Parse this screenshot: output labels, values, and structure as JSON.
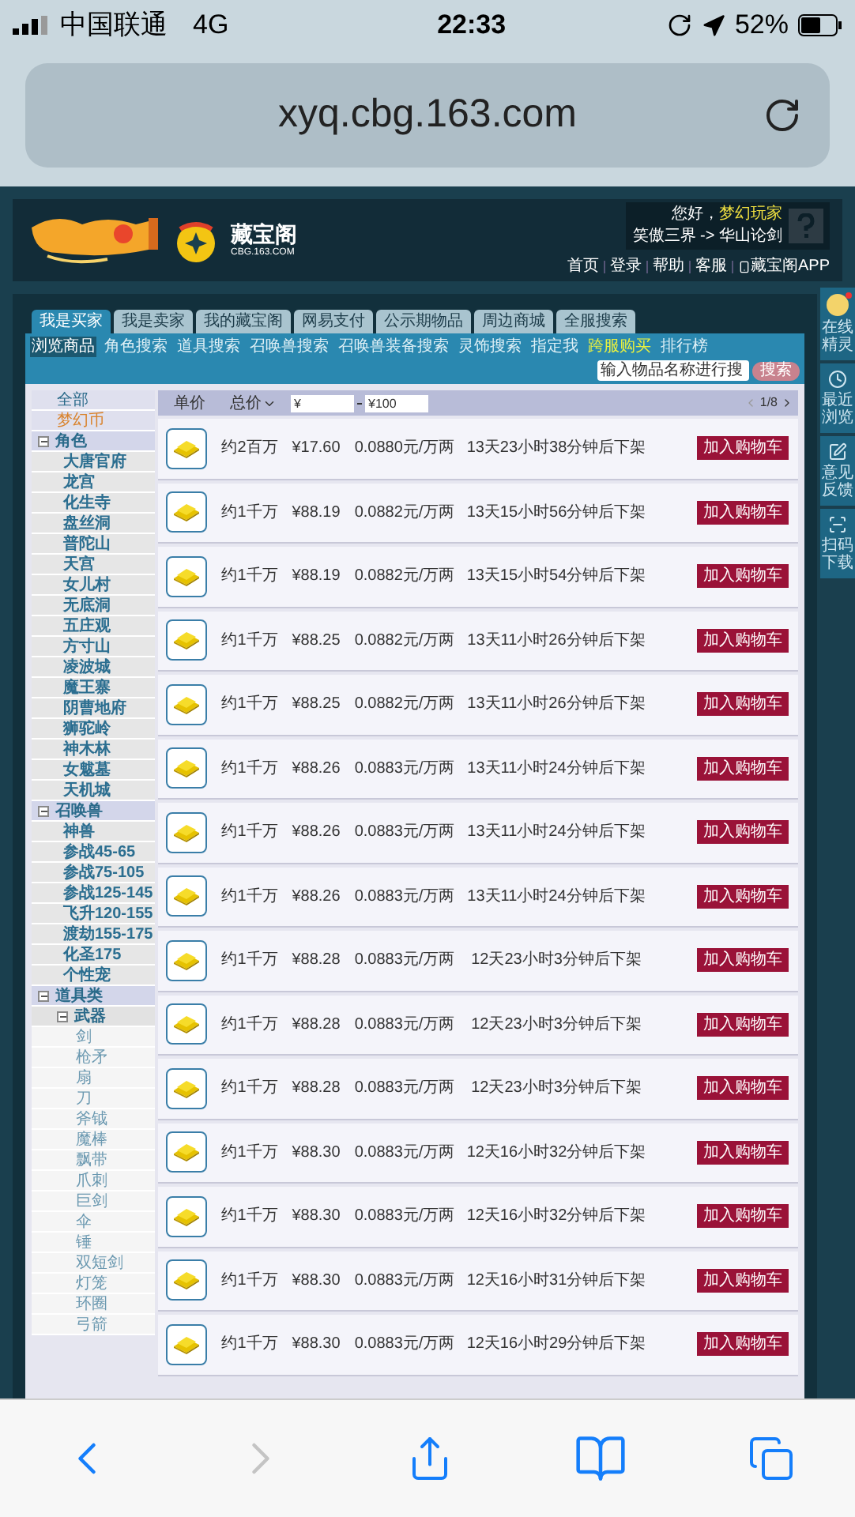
{
  "status_bar": {
    "carrier": "中国联通",
    "network": "4G",
    "time": "22:33",
    "battery": "52%"
  },
  "address_bar": {
    "url": "xyq.cbg.163.com"
  },
  "header": {
    "brand": "藏宝阁",
    "brand_sub": "CBG.163.COM",
    "greeting": "您好，",
    "username": "梦幻玩家",
    "server": "笑傲三界 -> 华山论剑",
    "links": [
      {
        "label": "首页",
        "kind": "text"
      },
      {
        "label": "登录",
        "kind": "text"
      },
      {
        "label": "帮助",
        "kind": "text"
      },
      {
        "label": "客服",
        "kind": "text"
      },
      {
        "label": "藏宝阁APP",
        "kind": "app"
      }
    ]
  },
  "tabs": [
    {
      "label": "我是买家",
      "selected": true
    },
    {
      "label": "我是卖家",
      "selected": false
    },
    {
      "label": "我的藏宝阁",
      "selected": false
    },
    {
      "label": "网易支付",
      "selected": false
    },
    {
      "label": "公示期物品",
      "selected": false
    },
    {
      "label": "周边商城",
      "selected": false
    },
    {
      "label": "全服搜索",
      "selected": false
    }
  ],
  "subnav": {
    "items": [
      {
        "label": "浏览商品",
        "selected": true,
        "highlighted": false
      },
      {
        "label": "角色搜索",
        "selected": false,
        "highlighted": false
      },
      {
        "label": "道具搜索",
        "selected": false,
        "highlighted": false
      },
      {
        "label": "召唤兽搜索",
        "selected": false,
        "highlighted": false
      },
      {
        "label": "召唤兽装备搜索",
        "selected": false,
        "highlighted": false
      },
      {
        "label": "灵饰搜索",
        "selected": false,
        "highlighted": false
      },
      {
        "label": "指定我",
        "selected": false,
        "highlighted": false
      },
      {
        "label": "跨服购买",
        "selected": false,
        "highlighted": true
      },
      {
        "label": "排行榜",
        "selected": false,
        "highlighted": false
      }
    ],
    "search_placeholder": "输入物品名称进行搜",
    "search_button": "搜索"
  },
  "sidebar": {
    "items": [
      {
        "label": "全部",
        "selected": false
      },
      {
        "label": "梦幻币",
        "selected": true
      },
      {
        "label": "角色",
        "selected": false,
        "expanded": true,
        "children": [
          {
            "label": "大唐官府",
            "selected": false
          },
          {
            "label": "龙宫",
            "selected": false
          },
          {
            "label": "化生寺",
            "selected": false
          },
          {
            "label": "盘丝洞",
            "selected": false
          },
          {
            "label": "普陀山",
            "selected": false
          },
          {
            "label": "天宫",
            "selected": false
          },
          {
            "label": "女儿村",
            "selected": false
          },
          {
            "label": "无底洞",
            "selected": false
          },
          {
            "label": "五庄观",
            "selected": false
          },
          {
            "label": "方寸山",
            "selected": false
          },
          {
            "label": "凌波城",
            "selected": false
          },
          {
            "label": "魔王寨",
            "selected": false
          },
          {
            "label": "阴曹地府",
            "selected": false
          },
          {
            "label": "狮驼岭",
            "selected": false
          },
          {
            "label": "神木林",
            "selected": false
          },
          {
            "label": "女魃墓",
            "selected": false
          },
          {
            "label": "天机城",
            "selected": false
          }
        ]
      },
      {
        "label": "召唤兽",
        "selected": false,
        "expanded": true,
        "children": [
          {
            "label": "神兽",
            "selected": false
          },
          {
            "label": "参战45-65",
            "selected": false
          },
          {
            "label": "参战75-105",
            "selected": false
          },
          {
            "label": "参战125-145",
            "selected": false
          },
          {
            "label": "飞升120-155",
            "selected": false
          },
          {
            "label": "渡劫155-175",
            "selected": false
          },
          {
            "label": "化圣175",
            "selected": false
          },
          {
            "label": "个性宠",
            "selected": false
          }
        ]
      },
      {
        "label": "道具类",
        "selected": false,
        "expanded": true,
        "children": [
          {
            "label": "武器",
            "selected": false,
            "expanded": true,
            "children": [
              {
                "label": "剑",
                "selected": false
              },
              {
                "label": "枪矛",
                "selected": false
              },
              {
                "label": "扇",
                "selected": false
              },
              {
                "label": "刀",
                "selected": false
              },
              {
                "label": "斧钺",
                "selected": false
              },
              {
                "label": "魔棒",
                "selected": false
              },
              {
                "label": "飘带",
                "selected": false
              },
              {
                "label": "爪刺",
                "selected": false
              },
              {
                "label": "巨剑",
                "selected": false
              },
              {
                "label": "伞",
                "selected": false
              },
              {
                "label": "锤",
                "selected": false
              },
              {
                "label": "双短剑",
                "selected": false
              },
              {
                "label": "灯笼",
                "selected": false
              },
              {
                "label": "环圈",
                "selected": false
              },
              {
                "label": "弓箭",
                "selected": false
              }
            ]
          }
        ]
      }
    ]
  },
  "table": {
    "columns": [
      "单价",
      "总价"
    ],
    "min_price": "¥",
    "max_price": "¥100",
    "page": "1/8",
    "rows": [
      {
        "amount": "约2百万",
        "price": "¥17.60",
        "unit_price": "0.0880元/万两",
        "expires": "13天23小时38分钟后下架",
        "button": "加入购物车"
      },
      {
        "amount": "约1千万",
        "price": "¥88.19",
        "unit_price": "0.0882元/万两",
        "expires": "13天15小时56分钟后下架",
        "button": "加入购物车"
      },
      {
        "amount": "约1千万",
        "price": "¥88.19",
        "unit_price": "0.0882元/万两",
        "expires": "13天15小时54分钟后下架",
        "button": "加入购物车"
      },
      {
        "amount": "约1千万",
        "price": "¥88.25",
        "unit_price": "0.0882元/万两",
        "expires": "13天11小时26分钟后下架",
        "button": "加入购物车"
      },
      {
        "amount": "约1千万",
        "price": "¥88.25",
        "unit_price": "0.0882元/万两",
        "expires": "13天11小时26分钟后下架",
        "button": "加入购物车"
      },
      {
        "amount": "约1千万",
        "price": "¥88.26",
        "unit_price": "0.0883元/万两",
        "expires": "13天11小时24分钟后下架",
        "button": "加入购物车"
      },
      {
        "amount": "约1千万",
        "price": "¥88.26",
        "unit_price": "0.0883元/万两",
        "expires": "13天11小时24分钟后下架",
        "button": "加入购物车"
      },
      {
        "amount": "约1千万",
        "price": "¥88.26",
        "unit_price": "0.0883元/万两",
        "expires": "13天11小时24分钟后下架",
        "button": "加入购物车"
      },
      {
        "amount": "约1千万",
        "price": "¥88.28",
        "unit_price": "0.0883元/万两",
        "expires": "12天23小时3分钟后下架",
        "button": "加入购物车"
      },
      {
        "amount": "约1千万",
        "price": "¥88.28",
        "unit_price": "0.0883元/万两",
        "expires": "12天23小时3分钟后下架",
        "button": "加入购物车"
      },
      {
        "amount": "约1千万",
        "price": "¥88.28",
        "unit_price": "0.0883元/万两",
        "expires": "12天23小时3分钟后下架",
        "button": "加入购物车"
      },
      {
        "amount": "约1千万",
        "price": "¥88.30",
        "unit_price": "0.0883元/万两",
        "expires": "12天16小时32分钟后下架",
        "button": "加入购物车"
      },
      {
        "amount": "约1千万",
        "price": "¥88.30",
        "unit_price": "0.0883元/万两",
        "expires": "12天16小时32分钟后下架",
        "button": "加入购物车"
      },
      {
        "amount": "约1千万",
        "price": "¥88.30",
        "unit_price": "0.0883元/万两",
        "expires": "12天16小时31分钟后下架",
        "button": "加入购物车"
      },
      {
        "amount": "约1千万",
        "price": "¥88.30",
        "unit_price": "0.0883元/万两",
        "expires": "12天16小时29分钟后下架",
        "button": "加入购物车"
      }
    ]
  },
  "side_rail": [
    {
      "label": "在线精灵",
      "kind": "avatar"
    },
    {
      "label": "最近浏览",
      "kind": "clock"
    },
    {
      "label": "意见反馈",
      "kind": "edit"
    },
    {
      "label": "扫码下载",
      "kind": "scan"
    }
  ],
  "toolbar": [
    {
      "kind": "back",
      "disabled": false
    },
    {
      "kind": "forward",
      "disabled": true
    },
    {
      "kind": "share",
      "disabled": false
    },
    {
      "kind": "bookmarks",
      "disabled": false
    },
    {
      "kind": "tabs",
      "disabled": false
    }
  ]
}
